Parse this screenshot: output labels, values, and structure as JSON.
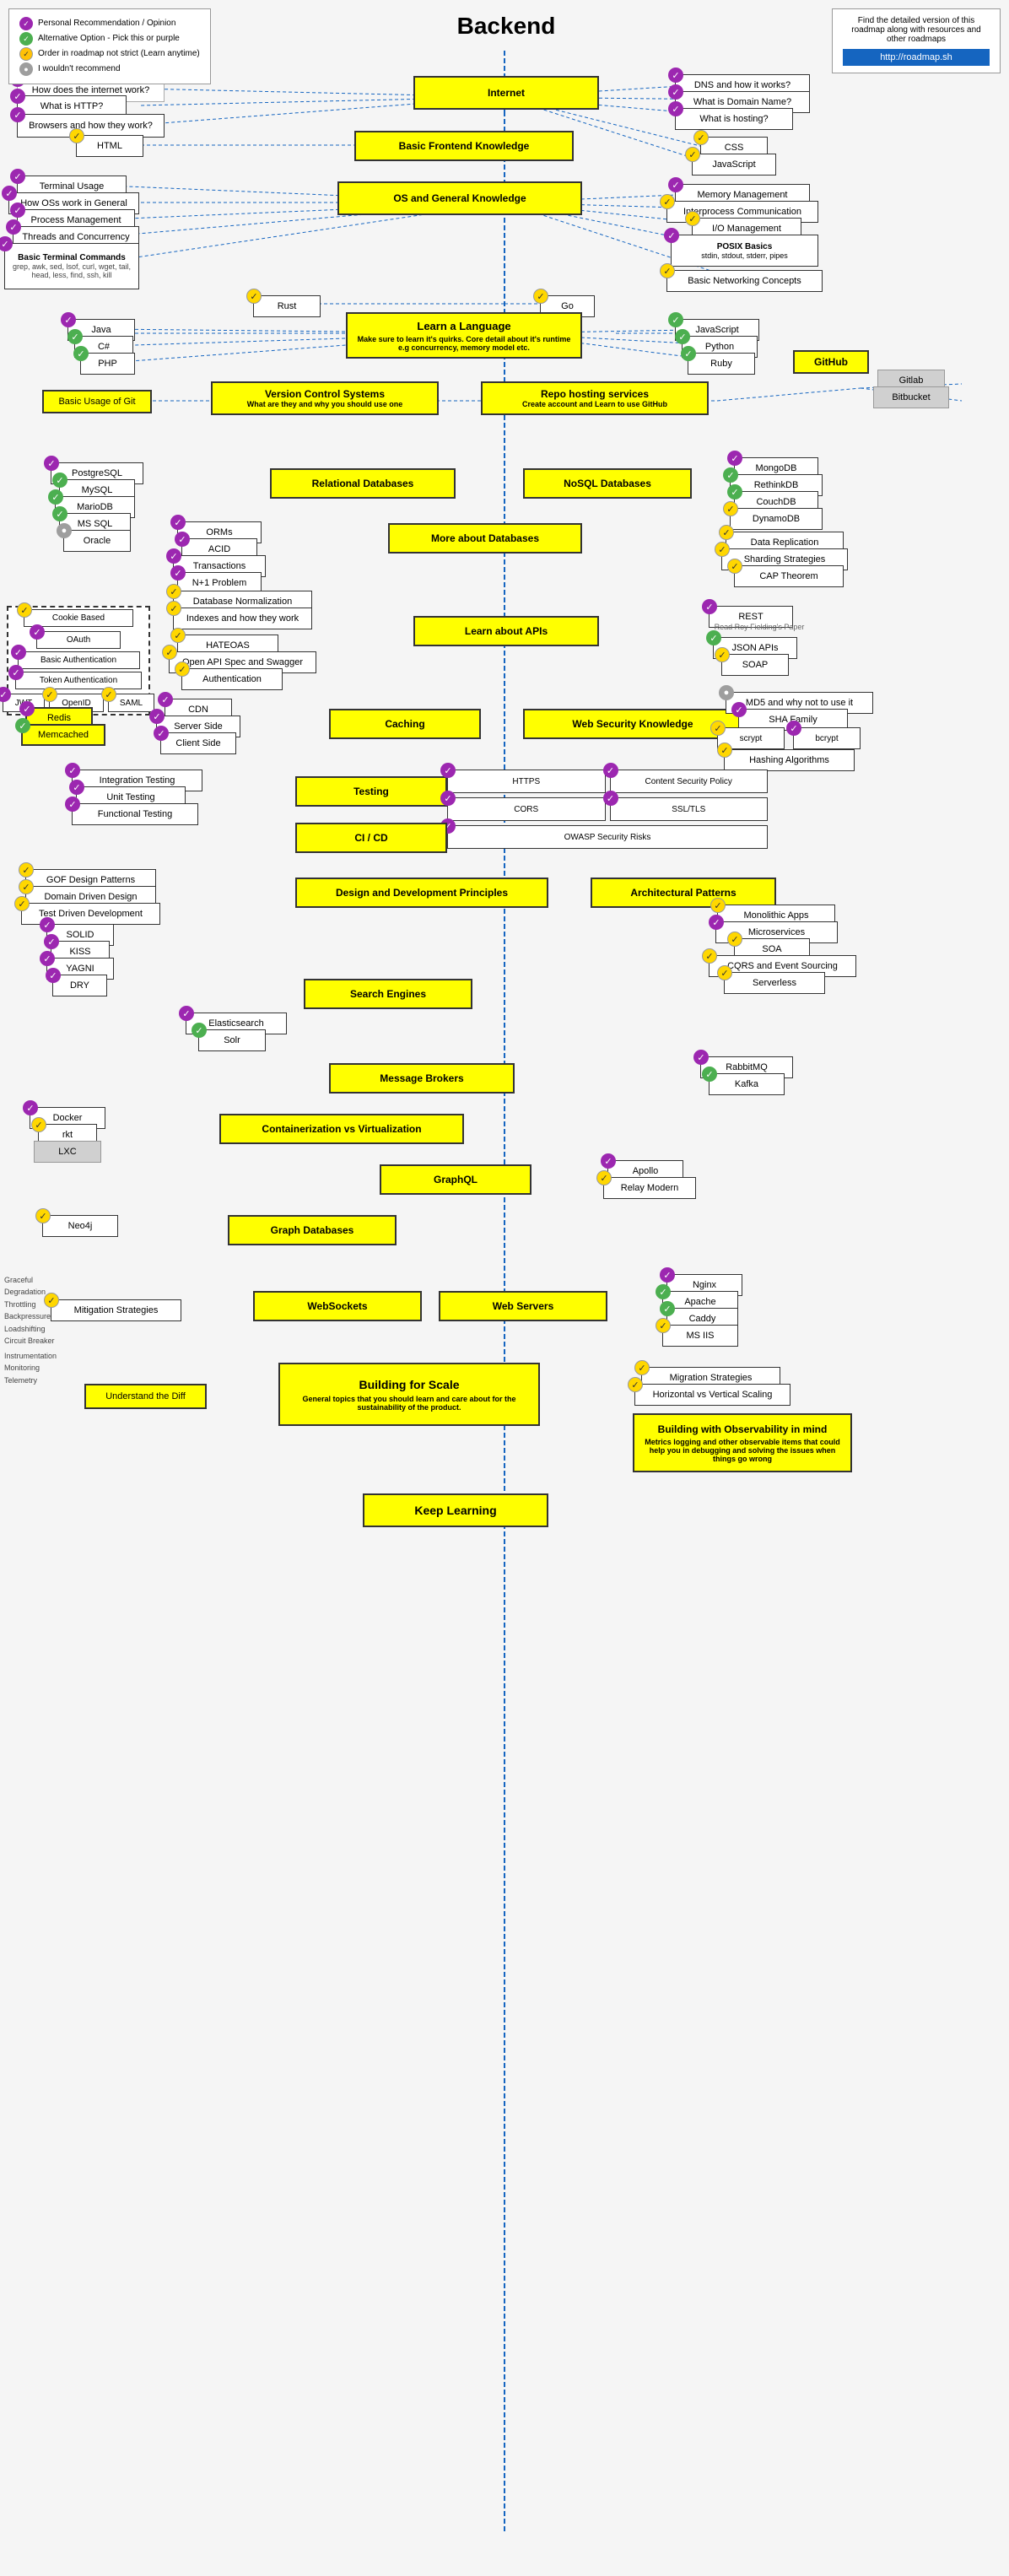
{
  "legend": {
    "items": [
      {
        "icon": "purple",
        "symbol": "✓",
        "text": "Personal Recommendation / Opinion"
      },
      {
        "icon": "green",
        "symbol": "✓",
        "text": "Alternative Option - Pick this or purple"
      },
      {
        "icon": "yellow",
        "symbol": "✓",
        "text": "Order in roadmap not strict (Learn anytime)"
      },
      {
        "icon": "gray",
        "symbol": "●",
        "text": "I wouldn't recommend"
      }
    ]
  },
  "roadmap": {
    "description": "Find the detailed version of this roadmap along with resources and other roadmaps",
    "url": "http://roadmap.sh"
  },
  "title": "Backend",
  "nodes": {
    "internet": "Internet",
    "basicFrontend": "Basic Frontend Knowledge",
    "osGeneral": "OS and General Knowledge",
    "learnLanguage": "Learn a Language",
    "learnLanguageDesc": "Make sure to learn it's quirks. Core detail about it's runtime e.g concurrency, memory model etc.",
    "vcs": "Version Control Systems",
    "vcsDesc": "What are they and why you should use one",
    "repoHosting": "Repo hosting services",
    "repoHostingDesc": "Create account and Learn to use GitHub",
    "relationalDB": "Relational Databases",
    "nosqlDB": "NoSQL Databases",
    "moreAboutDB": "More about Databases",
    "learnAPIs": "Learn about APIs",
    "caching": "Caching",
    "webSecurity": "Web Security Knowledge",
    "testing": "Testing",
    "cicd": "CI / CD",
    "designPrinciples": "Design and Development Principles",
    "searchEngines": "Search Engines",
    "architecturalPatterns": "Architectural Patterns",
    "messageBrokers": "Message Brokers",
    "containerization": "Containerization vs Virtualization",
    "graphql": "GraphQL",
    "graphDatabases": "Graph Databases",
    "webSockets": "WebSockets",
    "webServers": "Web Servers",
    "buildingForScale": "Building for Scale",
    "buildingForScaleDesc": "General topics that you should learn and care about for the sustainability of the product.",
    "understandDiff": "Understand the Diff",
    "keepLearning": "Keep Learning",
    "buildingObservability": "Building with Observability in mind",
    "buildingObservabilityDesc": "Metrics logging and other observable items that could help you in debugging and solving the issues when things go wrong"
  }
}
